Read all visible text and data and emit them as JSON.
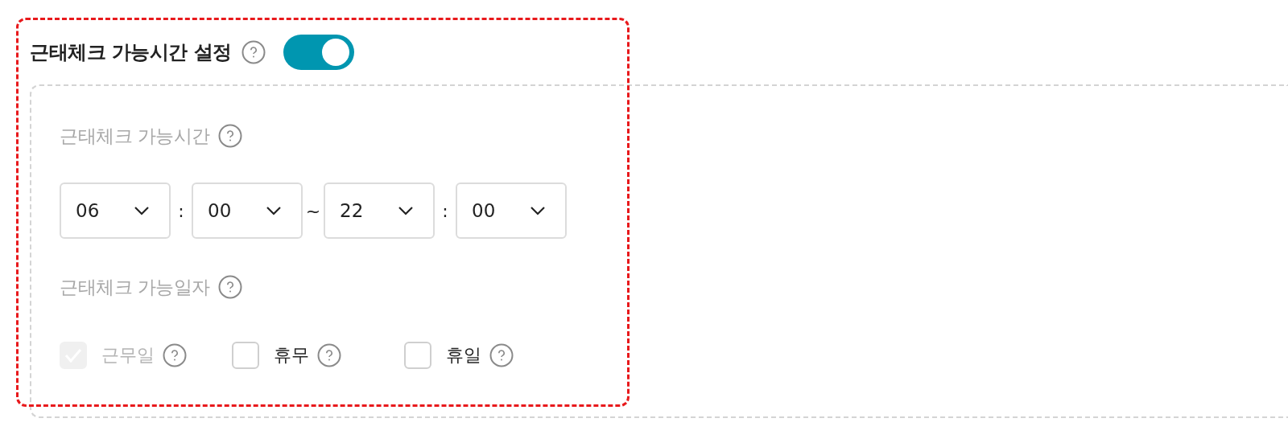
{
  "header": {
    "title": "근태체크 가능시간 설정",
    "toggle": {
      "on": true
    }
  },
  "time_section": {
    "label": "근태체크 가능시간",
    "items": [
      {
        "kind": "select",
        "value": "06"
      },
      {
        "kind": "separator",
        "text": ":"
      },
      {
        "kind": "select",
        "value": "00"
      },
      {
        "kind": "separator",
        "text": "~"
      },
      {
        "kind": "select",
        "value": "22"
      },
      {
        "kind": "separator",
        "text": ":"
      },
      {
        "kind": "select",
        "value": "00"
      }
    ]
  },
  "day_section": {
    "label": "근태체크 가능일자",
    "options": [
      {
        "label": "근무일",
        "checked": true,
        "disabled": true
      },
      {
        "label": "휴무",
        "checked": false,
        "disabled": false
      },
      {
        "label": "휴일",
        "checked": false,
        "disabled": false
      }
    ]
  }
}
